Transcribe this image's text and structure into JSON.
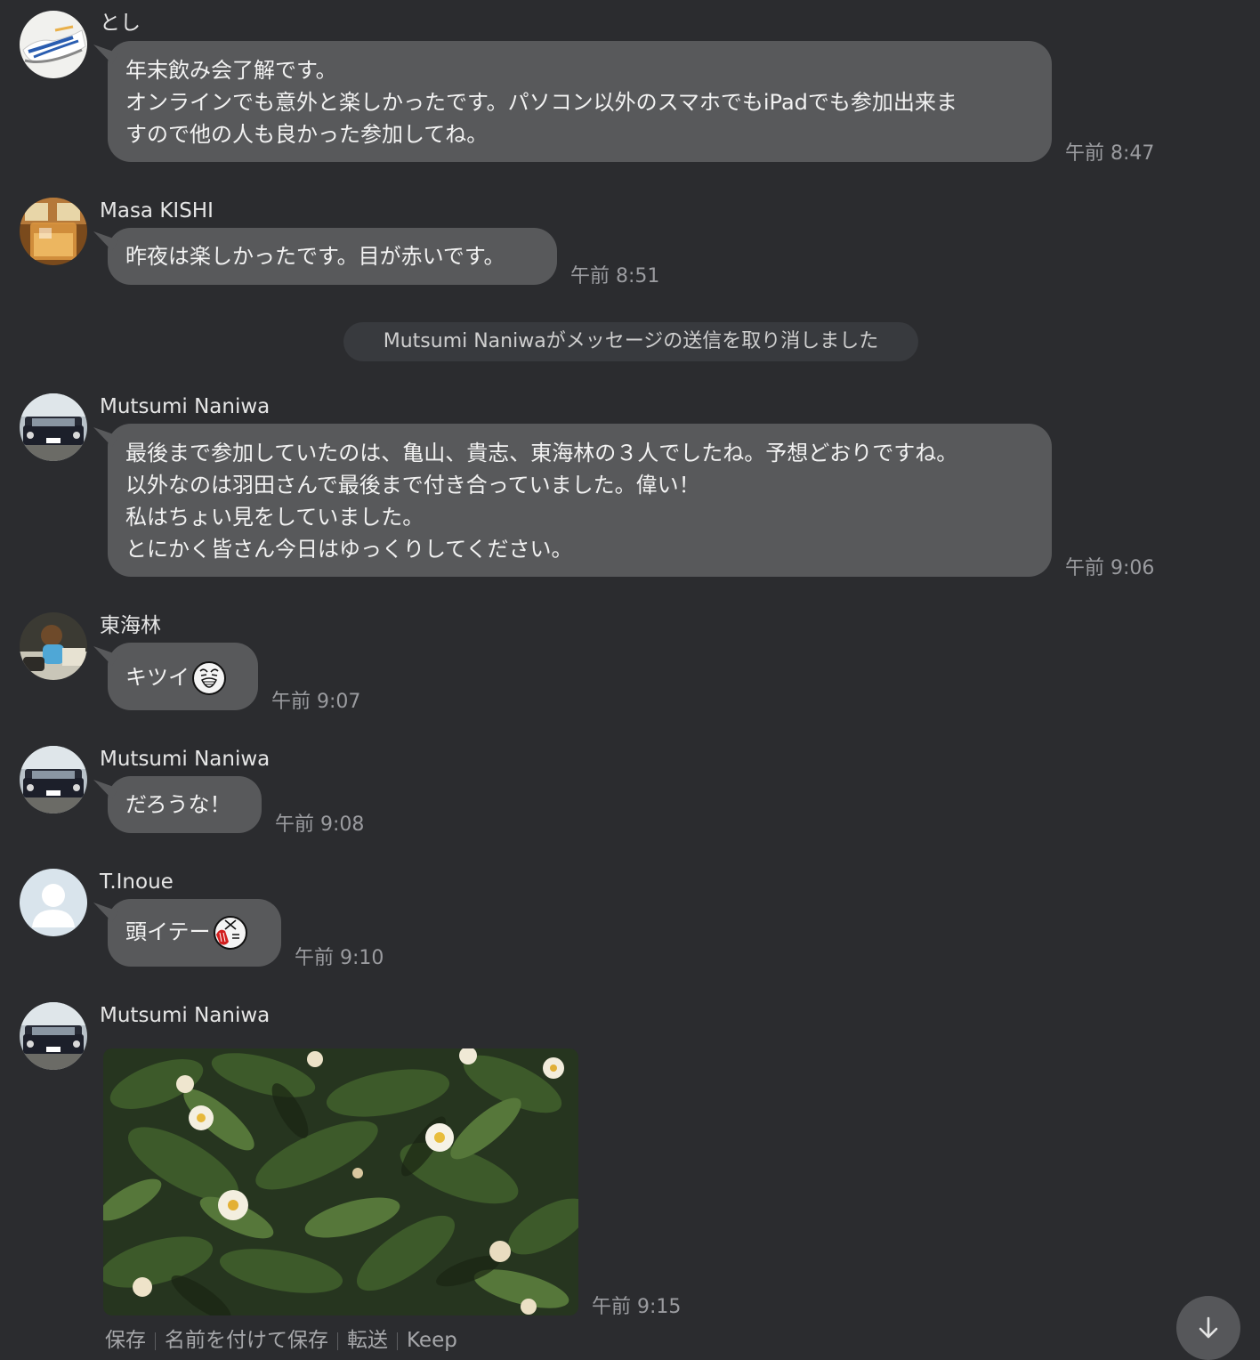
{
  "messages": [
    {
      "sender": "とし",
      "avatar_icon": "shoe-avatar-icon",
      "lines": [
        "年末飲み会了解です。",
        "オンラインでも意外と楽しかったです。パソコン以外のスマホでもiPadでも参加出来ま",
        "すので他の人も良かった参加してね。"
      ],
      "time": "午前 8:47"
    },
    {
      "sender": "Masa KISHI",
      "avatar_icon": "whisky-glass-avatar-icon",
      "lines": [
        "昨夜は楽しかったです。目が赤いです。"
      ],
      "time": "午前 8:51"
    },
    {
      "sender": "Mutsumi Naniwa",
      "avatar_icon": "car-avatar-icon",
      "lines": [
        "最後まで参加していたのは、亀山、貴志、東海林の３人でしたね。予想どおりですね。",
        "以外なのは羽田さんで最後まで付き合っていました。偉い！",
        "私はちょい見をしていました。",
        "とにかく皆さん今日はゆっくりしてください。"
      ],
      "time": "午前 9:06"
    },
    {
      "sender": "東海林",
      "avatar_icon": "person-photo-avatar-icon",
      "text": "キツイ",
      "emoji_icon": "tired-face-emoji-icon",
      "time": "午前 9:07"
    },
    {
      "sender": "Mutsumi Naniwa",
      "avatar_icon": "car-avatar-icon",
      "text": "だろうな！",
      "time": "午前 9:08"
    },
    {
      "sender": "T.Inoue",
      "avatar_icon": "default-user-avatar-icon",
      "text": "頭イテー",
      "emoji_icon": "headache-face-emoji-icon",
      "time": "午前 9:10"
    },
    {
      "sender": "Mutsumi Naniwa",
      "avatar_icon": "car-avatar-icon",
      "image_icon": "tea-flower-photo",
      "time": "午前 9:15"
    }
  ],
  "system_notice": "Mutsumi Naniwaがメッセージの送信を取り消しました",
  "image_actions": {
    "save": "保存",
    "save_as": "名前を付けて保存",
    "forward": "転送",
    "keep": "Keep"
  },
  "scroll_down_icon": "arrow-down-icon",
  "colors": {
    "background": "#2b2c2f",
    "bubble": "#58595b",
    "system_pill": "#383a3e",
    "timestamp": "#9b9ca0"
  }
}
